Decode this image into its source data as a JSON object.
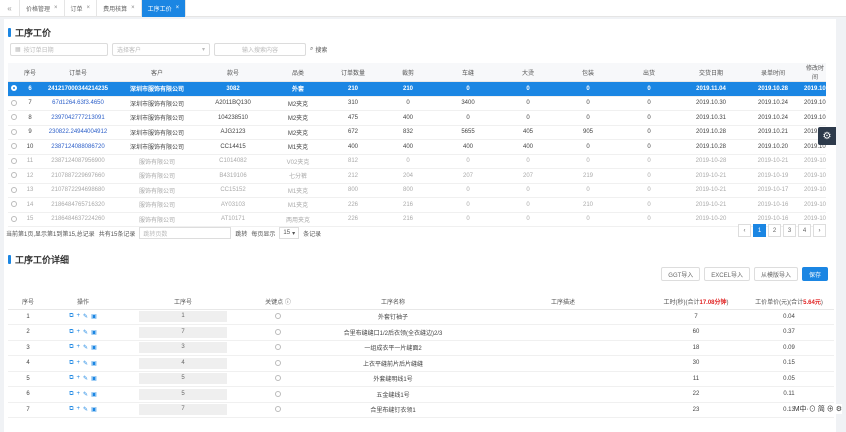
{
  "tabs": [
    {
      "label": "价格管理",
      "active": false
    },
    {
      "label": "订单",
      "active": false
    },
    {
      "label": "费用核算",
      "active": false
    },
    {
      "label": "工序工价",
      "active": true
    }
  ],
  "main": {
    "title": "工序工价",
    "filters": {
      "date_placeholder": "按订单日期",
      "customer_placeholder": "选择客户",
      "keyword_placeholder": "输入搜索内容",
      "search_label": "搜索"
    },
    "columns": [
      "序号",
      "订单号",
      "客户",
      "款号",
      "品类",
      "订单数量",
      "裁剪",
      "车缝",
      "大烫",
      "包装",
      "出货",
      "交货日期",
      "录单时间",
      "修改时间"
    ],
    "rows": [
      {
        "no": "6",
        "order": "241217000344214235",
        "customer": "深圳市服饰有限公司",
        "style": "3082",
        "category": "外套",
        "qty": "210",
        "cut": "210",
        "sew": "0",
        "iron": "0",
        "pack": "0",
        "ship": "0",
        "due": "2019.11.04",
        "created": "2019.10.28",
        "modified": "2019.10.28",
        "selected": true,
        "faded": false
      },
      {
        "no": "7",
        "order": "67d1264.63f3.4650",
        "customer": "深圳市服饰有限公司",
        "style": "A2011BQ130",
        "category": "M2夹克",
        "qty": "310",
        "cut": "0",
        "sew": "3400",
        "iron": "0",
        "pack": "0",
        "ship": "0",
        "due": "2019.10.30",
        "created": "2019.10.24",
        "modified": "2019.10.24",
        "selected": false,
        "faded": false
      },
      {
        "no": "8",
        "order": "2397042777213091",
        "customer": "深圳市服饰有限公司",
        "style": "104238510",
        "category": "M2夹克",
        "qty": "475",
        "cut": "400",
        "sew": "0",
        "iron": "0",
        "pack": "0",
        "ship": "0",
        "due": "2019.10.31",
        "created": "2019.10.24",
        "modified": "2019.10.24",
        "selected": false,
        "faded": false
      },
      {
        "no": "9",
        "order": "230822.24944004912",
        "customer": "深圳市服饰有限公司",
        "style": "AJG2123",
        "category": "M2夹克",
        "qty": "672",
        "cut": "832",
        "sew": "5655",
        "iron": "405",
        "pack": "905",
        "ship": "0",
        "due": "2019.10.28",
        "created": "2019.10.21",
        "modified": "2019.10.21",
        "selected": false,
        "faded": false
      },
      {
        "no": "10",
        "order": "2387124088086720",
        "customer": "深圳市服饰有限公司",
        "style": "CC14415",
        "category": "M1夹克",
        "qty": "400",
        "cut": "400",
        "sew": "400",
        "iron": "400",
        "pack": "0",
        "ship": "0",
        "due": "2019.10.28",
        "created": "2019.10.20",
        "modified": "2019.10.20",
        "selected": false,
        "faded": false
      },
      {
        "no": "11",
        "order": "2387124087956900",
        "customer": "服饰有限公司",
        "style": "C1014082",
        "category": "V02夹克",
        "qty": "812",
        "cut": "0",
        "sew": "0",
        "iron": "0",
        "pack": "0",
        "ship": "0",
        "due": "2019-10-28",
        "created": "2019-10-21",
        "modified": "2019-10-21",
        "selected": false,
        "faded": true
      },
      {
        "no": "12",
        "order": "2107887229697660",
        "customer": "服饰有限公司",
        "style": "B4319106",
        "category": "七分裤",
        "qty": "212",
        "cut": "204",
        "sew": "207",
        "iron": "207",
        "pack": "219",
        "ship": "0",
        "due": "2019-10-21",
        "created": "2019-10-19",
        "modified": "2019-10-19",
        "selected": false,
        "faded": true
      },
      {
        "no": "13",
        "order": "2107872294698680",
        "customer": "服饰有限公司",
        "style": "CC15152",
        "category": "M1夹克",
        "qty": "800",
        "cut": "800",
        "sew": "0",
        "iron": "0",
        "pack": "0",
        "ship": "0",
        "due": "2019-10-21",
        "created": "2019-10-17",
        "modified": "2019-10-17",
        "selected": false,
        "faded": true
      },
      {
        "no": "14",
        "order": "2186484765716320",
        "customer": "服饰有限公司",
        "style": "AY03103",
        "category": "M1夹克",
        "qty": "226",
        "cut": "216",
        "sew": "0",
        "iron": "0",
        "pack": "210",
        "ship": "0",
        "due": "2019-10-21",
        "created": "2019-10-16",
        "modified": "2019-10-16",
        "selected": false,
        "faded": true
      },
      {
        "no": "15",
        "order": "2186484637224260",
        "customer": "服饰有限公司",
        "style": "AT10171",
        "category": "两用夹克",
        "qty": "226",
        "cut": "216",
        "sew": "0",
        "iron": "0",
        "pack": "0",
        "ship": "0",
        "due": "2019-10-20",
        "created": "2019-10-16",
        "modified": "2019-10-16",
        "selected": false,
        "faded": true
      }
    ],
    "pagination": {
      "summary": "当前第1页,显示第1到第15,总记录",
      "total_text": "共有15条记录",
      "goto_placeholder": "跳转页数",
      "jump_label": "跳转",
      "page_size_label": "每页显示",
      "page_size": "15",
      "unit": "条记录",
      "pages": [
        "‹",
        "1",
        "2",
        "3",
        "4",
        "›"
      ],
      "current": "1"
    }
  },
  "detail": {
    "title": "工序工价详细",
    "buttons": {
      "ggt": "GGT导入",
      "excel": "EXCEL导入",
      "copy": "从模版导入",
      "save": "保存"
    },
    "columns": {
      "no": "序号",
      "op": "操作",
      "step_no": "工序号",
      "key": "关键点",
      "step_name": "工序名称",
      "step_note": "工序描述",
      "time_prefix": "工时(秒)",
      "time_total_label": "合计",
      "time_total": "17.08",
      "time_unit": "分钟",
      "price_prefix": "工价单价(元)",
      "price_total_label": "合计",
      "price_total": "5.64元"
    },
    "rows": [
      {
        "no": "1",
        "step_no": "1",
        "name": "外套钉袖子",
        "time": "7",
        "price": "0.04"
      },
      {
        "no": "2",
        "step_no": "7",
        "name": "合里布缝缝口1/2后衣领(全衣缝边)2/3",
        "time": "60",
        "price": "0.37"
      },
      {
        "no": "3",
        "step_no": "3",
        "name": "一组成衣平一片缝面2",
        "time": "18",
        "price": "0.09"
      },
      {
        "no": "4",
        "step_no": "4",
        "name": "上衣平缝前片后片缝缝",
        "time": "30",
        "price": "0.15"
      },
      {
        "no": "5",
        "step_no": "5",
        "name": "外套缝明线1号",
        "time": "11",
        "price": "0.05"
      },
      {
        "no": "6",
        "step_no": "5",
        "name": "五金缝线1号",
        "time": "22",
        "price": "0.11"
      },
      {
        "no": "7",
        "step_no": "7",
        "name": "合里布缝钉衣领1",
        "time": "23",
        "price": "0.13"
      }
    ]
  },
  "ime": {
    "label": "M中·⊙ 简 ⊕ ⚙"
  }
}
